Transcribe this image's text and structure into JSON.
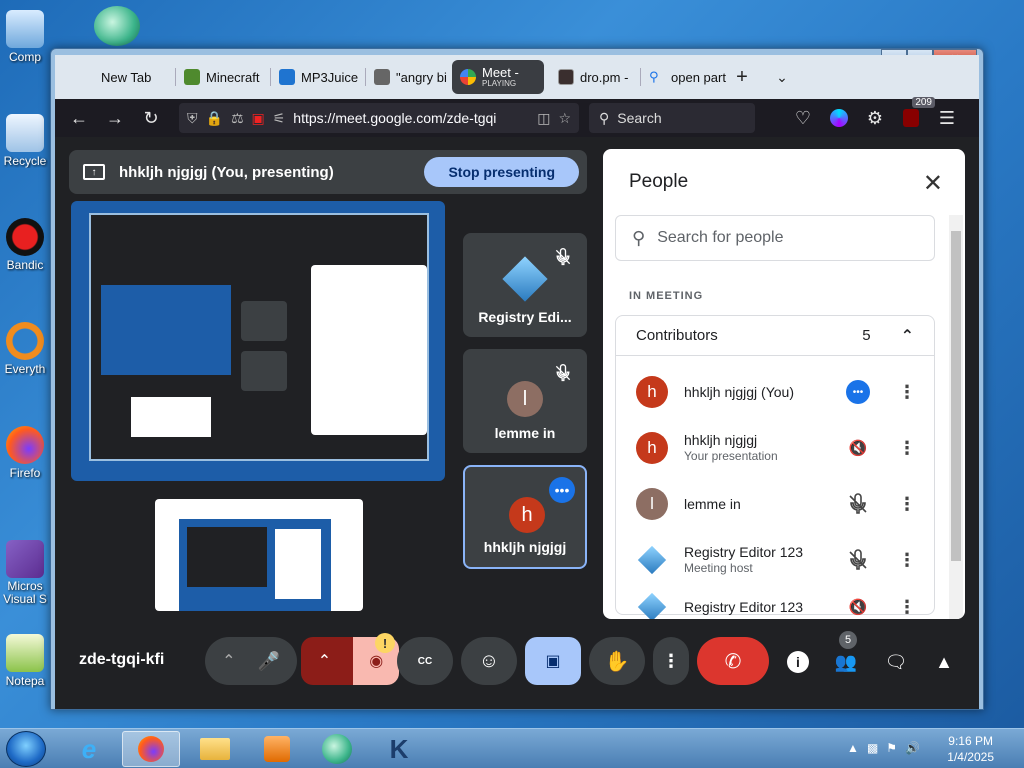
{
  "desktop": {
    "icons": [
      {
        "label": "Comp"
      },
      {
        "label": "Recycle"
      },
      {
        "label": "Bandic"
      },
      {
        "label": "Everyth"
      },
      {
        "label": "Firefo"
      },
      {
        "label": "Micros Visual S"
      },
      {
        "label": "Notepa"
      }
    ]
  },
  "browser": {
    "tabs": [
      {
        "label": "New Tab"
      },
      {
        "label": "Minecraft"
      },
      {
        "label": "MP3Juice"
      },
      {
        "label": "\"angry bi"
      },
      {
        "label": "Meet -",
        "sub": "PLAYING"
      },
      {
        "label": "dro.pm -"
      },
      {
        "label": "open part"
      }
    ],
    "url": "https://meet.google.com/zde-tgqi",
    "search_placeholder": "Search",
    "extension_badge": "209"
  },
  "meet": {
    "presenting_text": "hhkljh njgjgj (You, presenting)",
    "stop_presenting": "Stop presenting",
    "tiles": [
      {
        "name": "Registry Edi...",
        "initial": ""
      },
      {
        "name": "lemme in",
        "initial": "l"
      },
      {
        "name": "hhkljh njgjgj",
        "initial": "h"
      }
    ],
    "meeting_code": "zde-tgqi-kfi",
    "people_count_badge": "5",
    "camera_warning": "!"
  },
  "people_panel": {
    "title": "People",
    "search_placeholder": "Search for people",
    "section_label": "IN MEETING",
    "contributors_label": "Contributors",
    "contributors_count": "5",
    "people": [
      {
        "name": "hhkljh njgjgj (You)",
        "sub": "",
        "initial": "h",
        "color": "#c5391b"
      },
      {
        "name": "hhkljh njgjgj",
        "sub": "Your presentation",
        "initial": "h",
        "color": "#c5391b"
      },
      {
        "name": "lemme in",
        "sub": "",
        "initial": "l",
        "color": "#8d6e63"
      },
      {
        "name": "Registry Editor 123",
        "sub": "Meeting host",
        "initial": "",
        "color": "#4aa3df"
      },
      {
        "name": "Registry Editor 123",
        "sub": "",
        "initial": "",
        "color": "#4aa3df"
      }
    ]
  },
  "taskbar": {
    "time": "9:16 PM",
    "date": "1/4/2025"
  },
  "colors": {
    "meet_bg": "#202124",
    "accent_blue": "#a8c7fa",
    "end_call_red": "#dc362e",
    "avatar_orange": "#c5391b"
  }
}
